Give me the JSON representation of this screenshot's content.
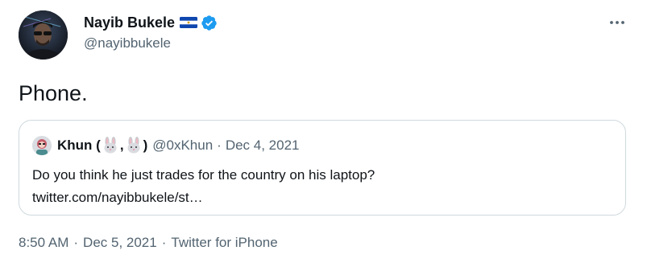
{
  "author": {
    "display_name": "Nayib Bukele",
    "handle": "@nayibbukele",
    "flag_icon": "el-salvador-flag-icon",
    "verified_icon": "verified-badge-icon",
    "verified_color": "#1d9bf0"
  },
  "tweet": {
    "text": "Phone."
  },
  "quote": {
    "name_prefix": "Khun (",
    "name_separator": ",",
    "name_suffix": ")",
    "name_emoji_icon": "rabbit-face-icon",
    "handle": "@0xKhun",
    "separator": "·",
    "date": "Dec 4, 2021",
    "body_line1": "Do you think he just trades for the country on his laptop?",
    "body_line2": "twitter.com/nayibbukele/st…"
  },
  "meta": {
    "time": "8:50 AM",
    "separator": "·",
    "date": "Dec 5, 2021",
    "source": "Twitter for iPhone"
  },
  "colors": {
    "text_primary": "#0f1419",
    "text_secondary": "#536471",
    "border": "#cfd9de",
    "accent": "#1d9bf0"
  }
}
